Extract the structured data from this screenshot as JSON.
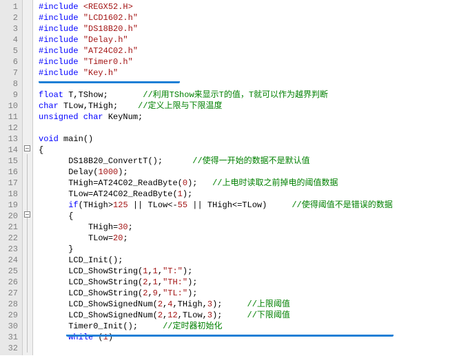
{
  "lines": {
    "num": [
      "1",
      "2",
      "3",
      "4",
      "5",
      "6",
      "7",
      "8",
      "9",
      "10",
      "11",
      "12",
      "13",
      "14",
      "15",
      "16",
      "17",
      "18",
      "19",
      "20",
      "21",
      "22",
      "23",
      "24",
      "25",
      "26",
      "27",
      "28",
      "29",
      "30",
      "31",
      "32"
    ]
  },
  "code": {
    "include": "#include",
    "hdr1": "<REGX52.H>",
    "hdr2": "\"LCD1602.h\"",
    "hdr3": "\"DS18B20.h\"",
    "hdr4": "\"Delay.h\"",
    "hdr5": "\"AT24C02.h\"",
    "hdr6": "\"Timer0.h\"",
    "hdr7": "\"Key.h\"",
    "kw_float": "float",
    "decl_T": " T,TShow;",
    "cmt_T": "//利用TShow来显示T的值，T就可以作为越界判断",
    "kw_char": "char",
    "decl_bounds": " TLow,THigh;",
    "cmt_bounds": "//定义上限与下限温度",
    "kw_uchar": "unsigned char",
    "decl_key": " KeyNum;",
    "kw_void": "void",
    "main_sig": " main()",
    "brace_open": "{",
    "brace_close": "}",
    "l15": "DS18B20_ConvertT();",
    "c15": "//使得一开始的数据不是默认值",
    "l16a": "Delay(",
    "l16n": "1000",
    "l16b": ");",
    "l17a": "THigh=AT24C02_ReadByte(",
    "l17n": "0",
    "l17b": ");",
    "c17": "//上电时读取之前掉电的阈值数据",
    "l18a": "TLow=AT24C02_ReadByte(",
    "l18n": "1",
    "l18b": ");",
    "kw_if": "if",
    "l19a": "(THigh>",
    "l19n1": "125",
    "l19b": " || TLow<-",
    "l19n2": "55",
    "l19c": " || THigh<=TLow)",
    "c19": "//使得阈值不是错误的数据",
    "l21a": "THigh=",
    "l21n": "30",
    "l21b": ";",
    "l22a": "TLow=",
    "l22n": "20",
    "l22b": ";",
    "l24": "LCD_Init();",
    "l25a": "LCD_ShowString(",
    "l25n1": "1",
    "comma": ",",
    "l25n2": "1",
    "l25s": "\"T:\"",
    "l25b": ");",
    "l26n1": "2",
    "l26n2": "1",
    "l26s": "\"TH:\"",
    "l27n1": "2",
    "l27n2": "9",
    "l27s": "\"TL:\"",
    "l28a": "LCD_ShowSignedNum(",
    "l28n1": "2",
    "l28n2": "4",
    "l28v": "THigh",
    "l28n3": "3",
    "c28": "//上限阈值",
    "l29n2": "12",
    "l29v": "TLow",
    "c29": "//下限阈值",
    "l30": "Timer0_Init();",
    "c30": "//定时器初始化",
    "kw_while": "while",
    "l31a": " (",
    "l31n": "1",
    "l31b": ")"
  }
}
